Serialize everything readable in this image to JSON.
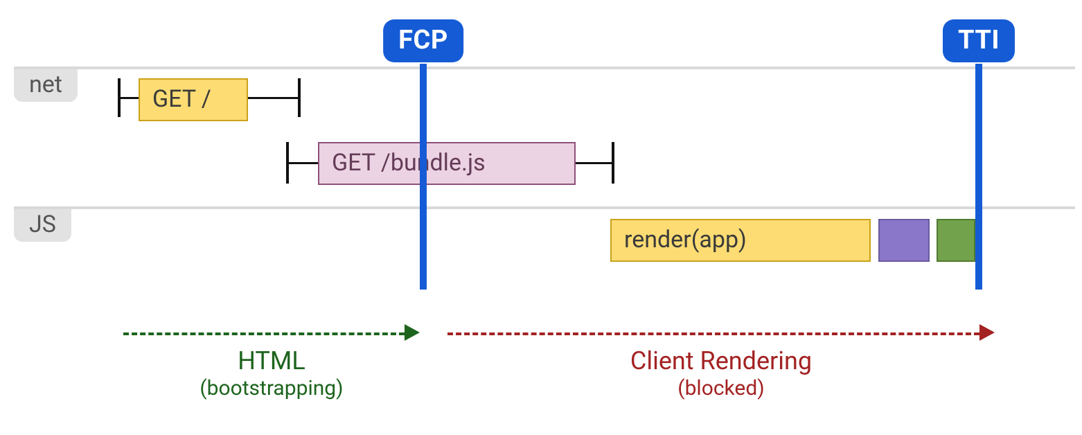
{
  "markers": {
    "fcp": "FCP",
    "tti": "TTI"
  },
  "lanes": {
    "net": "net",
    "js": "JS"
  },
  "requests": {
    "root": "GET /",
    "bundle": "GET /bundle.js"
  },
  "js_tasks": {
    "render": "render(app)"
  },
  "phases": {
    "html": {
      "title": "HTML",
      "sub": "(bootstrapping)"
    },
    "client": {
      "title": "Client Rendering",
      "sub": "(blocked)"
    }
  },
  "colors": {
    "marker_blue": "#155bd5",
    "get_yellow": "#fcdc73",
    "bundle_pink": "#ecd3e3",
    "task_purple": "#8b77c9",
    "task_green": "#72a34c",
    "phase_green": "#1d641d",
    "phase_red": "#a42222"
  },
  "chart_data": {
    "type": "timeline",
    "title": "Client-side rendering timeline: FCP vs TTI",
    "time_axis": {
      "unit": "relative",
      "range": [
        0,
        100
      ]
    },
    "markers": [
      {
        "name": "FCP",
        "t": 38
      },
      {
        "name": "TTI",
        "t": 97
      }
    ],
    "lanes": [
      {
        "name": "net",
        "items": [
          {
            "label": "GET /",
            "start": 8,
            "end": 20,
            "whisker_start": 5,
            "whisker_end": 27,
            "color": "yellow"
          },
          {
            "label": "GET /bundle.js",
            "start": 28,
            "end": 52,
            "whisker_start": 25,
            "whisker_end": 56,
            "color": "pink"
          }
        ]
      },
      {
        "name": "JS",
        "items": [
          {
            "label": "render(app)",
            "start": 56,
            "end": 85,
            "color": "yellow"
          },
          {
            "label": "",
            "start": 86,
            "end": 92,
            "color": "purple"
          },
          {
            "label": "",
            "start": 93,
            "end": 97,
            "color": "green"
          }
        ]
      }
    ],
    "phases": [
      {
        "label": "HTML",
        "sub": "(bootstrapping)",
        "start": 8,
        "end": 38,
        "color": "green"
      },
      {
        "label": "Client Rendering",
        "sub": "(blocked)",
        "start": 42,
        "end": 98,
        "color": "red"
      }
    ]
  }
}
